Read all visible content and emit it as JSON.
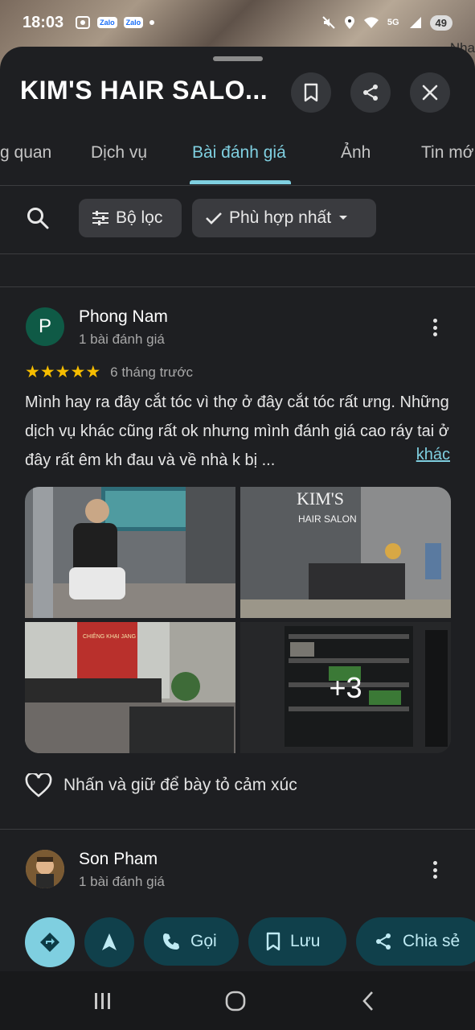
{
  "status_bar": {
    "time": "18:03",
    "app_icons": [
      "screenshot-icon",
      "Zalo",
      "Zalo"
    ],
    "network_label": "5G",
    "battery": "49"
  },
  "map": {
    "label": "Nha"
  },
  "place": {
    "title": "KIM'S HAIR SALO..."
  },
  "tabs": [
    {
      "label": "g quan"
    },
    {
      "label": "Dịch vụ"
    },
    {
      "label": "Bài đánh giá",
      "active": true
    },
    {
      "label": "Ảnh"
    },
    {
      "label": "Tin mớ"
    }
  ],
  "filters": {
    "filter_label": "Bộ lọc",
    "sort_label": "Phù hợp nhất"
  },
  "reviews": [
    {
      "initial": "P",
      "avatar_color": "#0f5a46",
      "name": "Phong Nam",
      "count": "1 bài đánh giá",
      "rating": 5,
      "ago": "6 tháng trước",
      "text": "Mình hay ra đây cắt tóc vì thợ ở đây cắt tóc rất ưng. Những dịch vụ khác cũng rất ok nhưng mình đánh giá cao ráy tai ở đây rất êm kh đau và về nhà k bị ...",
      "more": "khác",
      "photos_extra": "+3",
      "photo_brand_line1": "KIM'S",
      "photo_brand_line2": "HAIR SALON",
      "photo_shop_sign": "CHIÊNG KHẠI JANG",
      "react_label": "Nhấn và giữ để bày tỏ cảm xúc"
    },
    {
      "name": "Son Pham",
      "count": "1 bài đánh giá"
    }
  ],
  "actions": {
    "call": "Gọi",
    "save": "Lưu",
    "share": "Chia sẻ"
  },
  "colors": {
    "accent": "#7fcfe0",
    "star": "#f6bd00",
    "fab_directions": "#7fcfe0",
    "pill_bg": "#10404b"
  }
}
